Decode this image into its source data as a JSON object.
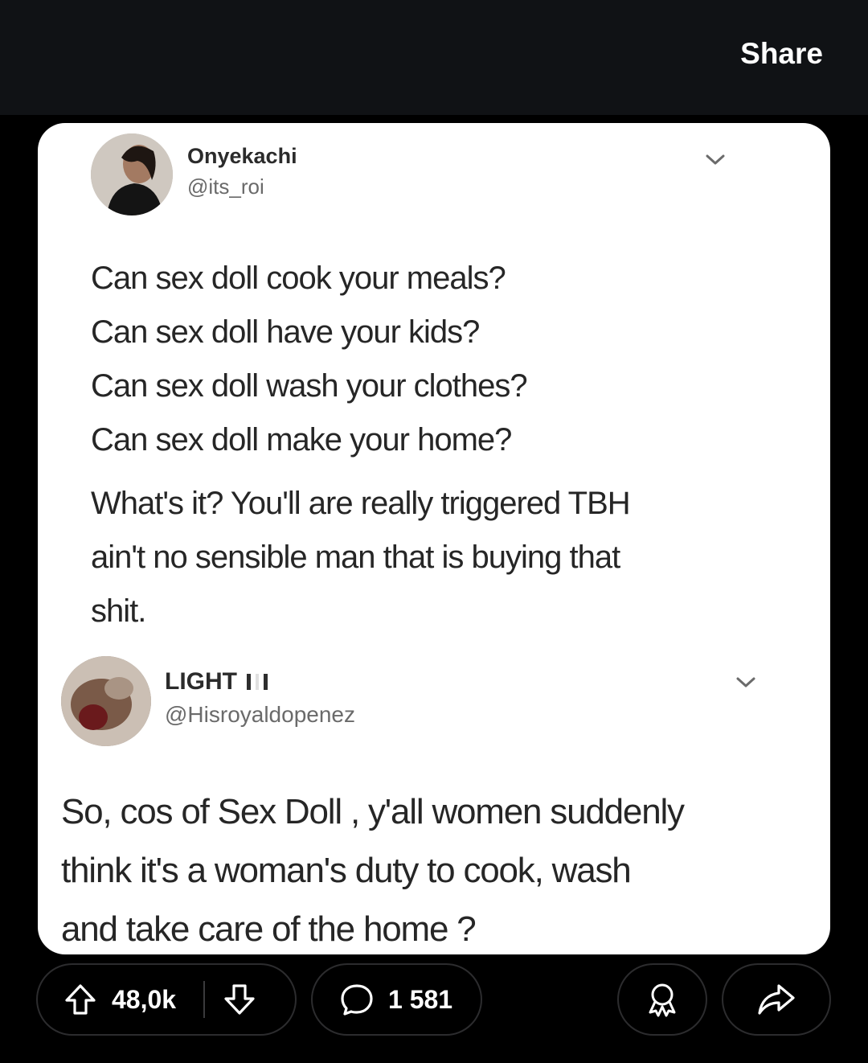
{
  "header": {
    "share_label": "Share"
  },
  "post": {
    "tweet1": {
      "name": "Onyekachi",
      "handle": "@its_roi",
      "lines": [
        "Can sex doll cook your meals?",
        "Can sex doll have your kids?",
        "Can sex doll wash your clothes?",
        "Can sex doll make your home?"
      ],
      "paragraph2_lines": [
        "What's it? You'll are really triggered TBH",
        "ain't no sensible man that is buying that",
        "shit."
      ]
    },
    "tweet2": {
      "name": "LIGHT",
      "handle": "@Hisroyaldopenez",
      "lines": [
        "So, cos of Sex Doll , y'all women suddenly",
        "think it's a woman's duty to cook, wash",
        "and take care of the home ?"
      ]
    }
  },
  "actions": {
    "upvote_count": "48,0k",
    "comment_count": "1 581"
  },
  "colors": {
    "background": "#000000",
    "topbar": "#101215",
    "card": "#ffffff"
  },
  "icons": [
    "chevron-down-icon",
    "upvote-arrow-icon",
    "downvote-arrow-icon",
    "comment-bubble-icon",
    "award-icon",
    "share-arrow-icon",
    "nigeria-flag-icon"
  ]
}
